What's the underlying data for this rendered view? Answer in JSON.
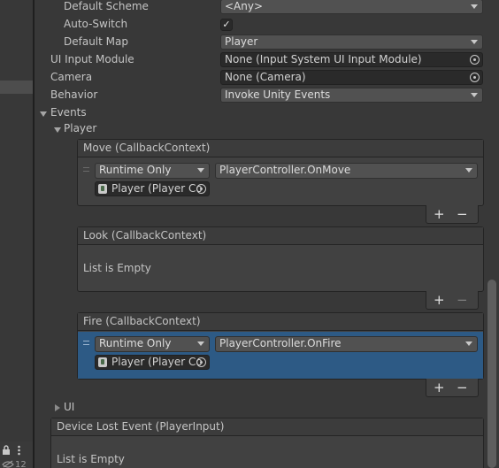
{
  "window": {
    "bottom_count": "12"
  },
  "props": {
    "default_scheme": {
      "label": "Default Scheme",
      "value": "<Any>"
    },
    "auto_switch": {
      "label": "Auto-Switch",
      "checked": "✓"
    },
    "default_map": {
      "label": "Default Map",
      "value": "Player"
    },
    "ui_input_module": {
      "label": "UI Input Module",
      "value": "None (Input System UI Input Module)"
    },
    "camera": {
      "label": "Camera",
      "value": "None (Camera)"
    },
    "behavior": {
      "label": "Behavior",
      "value": "Invoke Unity Events"
    }
  },
  "events": {
    "label": "Events",
    "player": {
      "label": "Player",
      "move": {
        "header": "Move (CallbackContext)",
        "runtime": "Runtime Only",
        "function": "PlayerController.OnMove",
        "object": "Player (Player Co"
      },
      "look": {
        "header": "Look (CallbackContext)",
        "empty": "List is Empty"
      },
      "fire": {
        "header": "Fire (CallbackContext)",
        "runtime": "Runtime Only",
        "function": "PlayerController.OnFire",
        "object": "Player (Player Co"
      }
    },
    "ui": {
      "label": "UI"
    }
  },
  "device_lost": {
    "header": "Device Lost Event (PlayerInput)",
    "empty": "List is Empty"
  },
  "footer": {
    "plus": "+",
    "minus": "−"
  },
  "colors": {
    "selected_row": "#2d5a85",
    "background": "#383838"
  },
  "icons": {
    "lock": "lock-icon",
    "menu": "kebab-menu-icon",
    "eye": "visibility-icon"
  }
}
